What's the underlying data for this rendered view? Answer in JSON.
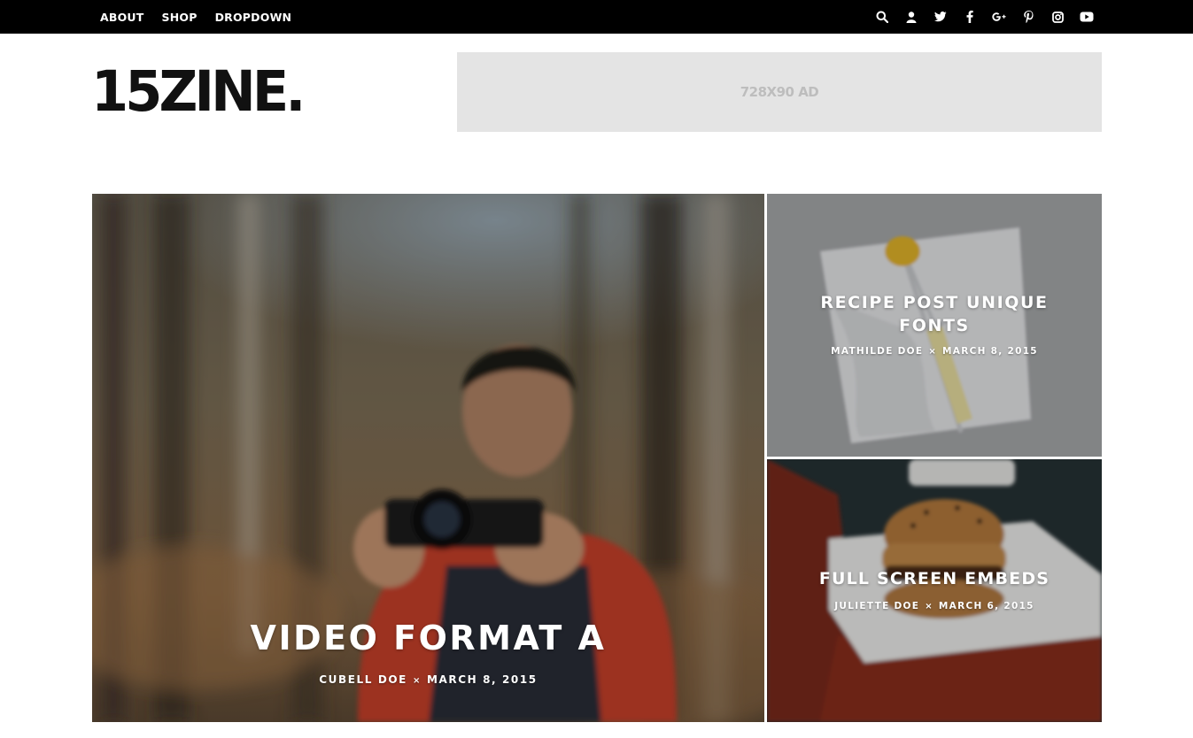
{
  "nav": {
    "items": [
      {
        "label": "ABOUT"
      },
      {
        "label": "SHOP"
      },
      {
        "label": "DROPDOWN"
      }
    ]
  },
  "social_icons": [
    "search-icon",
    "user-icon",
    "twitter-icon",
    "facebook-icon",
    "google-plus-icon",
    "pinterest-icon",
    "instagram-icon",
    "youtube-icon"
  ],
  "header": {
    "logo": "15ZINE.",
    "ad_text": "728X90 AD"
  },
  "featured": {
    "main": {
      "title": "VIDEO FORMAT A",
      "author": "CUBELL DOE",
      "separator": "×",
      "date": "MARCH 8, 2015"
    },
    "side_top": {
      "title": "RECIPE POST UNIQUE FONTS",
      "author": "MATHILDE DOE",
      "separator": "×",
      "date": "MARCH 8, 2015"
    },
    "side_bottom": {
      "title": "FULL SCREEN EMBEDS",
      "author": "JULIETTE DOE",
      "separator": "×",
      "date": "MARCH 6, 2015"
    }
  },
  "colors": {
    "topbar": "#000000",
    "ad_bg": "#e4e4e4",
    "ad_text": "#bdbdbd",
    "logo": "#111111"
  }
}
